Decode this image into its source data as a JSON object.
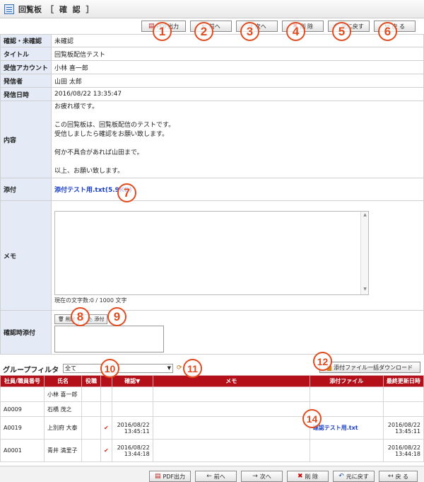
{
  "window": {
    "title": "回覧板",
    "mode": "［ 確 認 ］"
  },
  "toolbar": {
    "pdf": "PDF出力",
    "prev": "前へ",
    "next": "次へ",
    "delete": "削 除",
    "back_orig": "元に戻す",
    "back": "戻 る"
  },
  "fields": {
    "status_label": "確認・未確認",
    "status_value": "未確認",
    "title_label": "タイトル",
    "title_value": "回覧板配信テスト",
    "account_label": "受信アカウント",
    "account_value": "小林 喜一郎",
    "sender_label": "発信者",
    "sender_value": "山田 太郎",
    "date_label": "発信日時",
    "date_value": "2016/08/22 13:35:47",
    "content_label": "内容",
    "content_lines": [
      "お疲れ様です。",
      "",
      "この回覧板は、回覧板配信のテストです。",
      "受信しましたら確認をお願い致します。",
      "",
      "何か不具合があれば山田まで。",
      "",
      "以上、お願い致します。"
    ],
    "attach_label": "添付",
    "attach_file": "添付テスト用.txt(5.9KB)",
    "memo_label": "メモ",
    "memo_counter": "現在の文字数:0 / 1000 文字",
    "confirm_attach_label": "確認時添付",
    "delete_btn": "削除",
    "attach_btn": "添付"
  },
  "filter": {
    "label": "グループフィルタ",
    "selected": "全て",
    "download_btn": "添付ファイル一括ダウンロード"
  },
  "list": {
    "headers": [
      "社員/職員番号",
      "氏名",
      "役職",
      "",
      "確認▼",
      "メモ",
      "添付ファイル",
      "最終更新日時"
    ],
    "rows": [
      {
        "id": "",
        "name": "小林 喜一郎",
        "role": "",
        "check": "",
        "confirm_date": "",
        "confirm_time": "",
        "memo": "",
        "file": "",
        "upd_date": "",
        "upd_time": ""
      },
      {
        "id": "A0009",
        "name": "石橋 茂之",
        "role": "",
        "check": "",
        "confirm_date": "",
        "confirm_time": "",
        "memo": "",
        "file": "",
        "upd_date": "",
        "upd_time": ""
      },
      {
        "id": "A0019",
        "name": "上別府 大泰",
        "role": "",
        "check": "✔",
        "confirm_date": "2016/08/22",
        "confirm_time": "13:45:11",
        "memo": "",
        "file": "確認テスト用.txt",
        "upd_date": "2016/08/22",
        "upd_time": "13:45:11"
      },
      {
        "id": "A0001",
        "name": "青井 満里子",
        "role": "",
        "check": "✔",
        "confirm_date": "2016/08/22",
        "confirm_time": "13:44:18",
        "memo": "",
        "file": "",
        "upd_date": "2016/08/22",
        "upd_time": "13:44:18"
      }
    ]
  },
  "markers": [
    "1",
    "2",
    "3",
    "4",
    "5",
    "6",
    "7",
    "8",
    "9",
    "10",
    "11",
    "12",
    "14"
  ]
}
